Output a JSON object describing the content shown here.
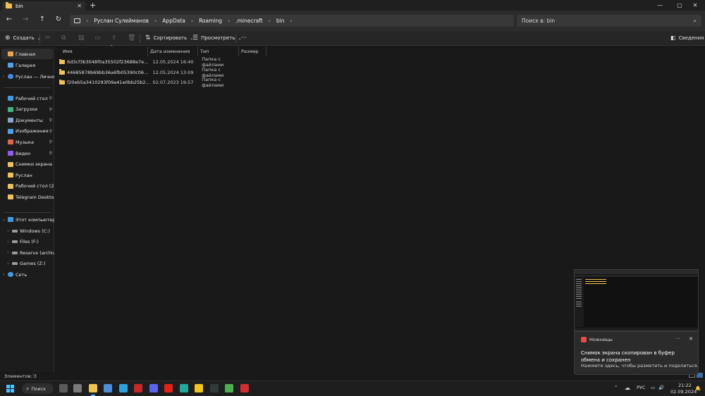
{
  "tab": {
    "title": "bin",
    "close": "✕",
    "new": "+"
  },
  "window_controls": {
    "minimize": "—",
    "maximize": "▢",
    "close": "✕"
  },
  "nav": {
    "back": "←",
    "forward": "→",
    "up": "↑",
    "refresh": "↻"
  },
  "breadcrumbs": [
    "Руслан Сулейманов",
    "AppData",
    "Roaming",
    ".minecraft",
    "bin"
  ],
  "search": {
    "placeholder": "Поиск в: bin"
  },
  "commands": {
    "create": "Создать",
    "sort": "Сортировать",
    "view": "Просмотреть",
    "more": "···",
    "details": "Сведения"
  },
  "sidebar": {
    "top": [
      {
        "label": "Главная",
        "icon": "home-icon",
        "color": "#f0a14a",
        "active": true
      },
      {
        "label": "Галерея",
        "icon": "gallery-icon",
        "color": "#4aa3f0"
      },
      {
        "label": "Руслан — Личное",
        "icon": "onedrive-icon",
        "color": "#3c8ee6"
      }
    ],
    "pinned": [
      {
        "label": "Рабочий стол",
        "icon": "desktop-icon",
        "color": "#3d9be9",
        "pin": "📌"
      },
      {
        "label": "Загрузки",
        "icon": "download-icon",
        "color": "#3fb27f",
        "pin": "📌"
      },
      {
        "label": "Документы",
        "icon": "documents-icon",
        "color": "#8aa4c8",
        "pin": "📌"
      },
      {
        "label": "Изображения",
        "icon": "pictures-icon",
        "color": "#4aa3f0",
        "pin": "📌"
      },
      {
        "label": "Музыка",
        "icon": "music-icon",
        "color": "#e8624a",
        "pin": "📌"
      },
      {
        "label": "Видео",
        "icon": "video-icon",
        "color": "#8b5cf6",
        "pin": "📌"
      },
      {
        "label": "Снимки экрана",
        "icon": "folder-icon",
        "color": "#f2c14e"
      },
      {
        "label": "Руслан",
        "icon": "folder-icon",
        "color": "#f2c14e"
      },
      {
        "label": "Рабочий стол (25.0",
        "icon": "folder-icon",
        "color": "#f2c14e"
      },
      {
        "label": "Telegram Desktop",
        "icon": "folder-icon",
        "color": "#f2c14e"
      }
    ],
    "this_pc": {
      "label": "Этот компьютер",
      "icon": "computer-icon",
      "color": "#3d9be9"
    },
    "drives": [
      {
        "label": "Windows (C:)",
        "icon": "drive-icon"
      },
      {
        "label": "Files (F:)",
        "icon": "drive-icon"
      },
      {
        "label": "Reserve (archive)",
        "icon": "drive-icon"
      },
      {
        "label": "Games (Z:)",
        "icon": "drive-icon"
      }
    ],
    "network": {
      "label": "Сеть",
      "icon": "network-icon",
      "color": "#3d9be9"
    }
  },
  "columns": {
    "name": "Имя",
    "date": "Дата изменения",
    "type": "Тип",
    "size": "Размер"
  },
  "files": [
    {
      "name": "6d3cf3b3048f0a35502f23688e7e2a47d68...",
      "date": "12.05.2024 16:40",
      "type": "Папка с файлами"
    },
    {
      "name": "44685878b69bb36a6fb05390c06c8b0243...",
      "date": "12.05.2024 13:09",
      "type": "Папка с файлами"
    },
    {
      "name": "f20eb5a3410293f09a41e0bb25b2fc3d98f...",
      "date": "02.07.2023 19:57",
      "type": "Папка с файлами"
    }
  ],
  "status": {
    "items": "Элементов: 3"
  },
  "notification": {
    "app": "Ножницы",
    "menu": "···",
    "close": "✕",
    "title": "Снимок экрана скопирован в буфер обмена и сохранен",
    "body": "Нажмите здесь, чтобы разметить и поделиться."
  },
  "taskbar": {
    "search": "Поиск",
    "lang": "РУС",
    "time": "21:22",
    "date": "02.09.2024",
    "apps": [
      {
        "name": "taskview-icon",
        "color": "#5a5a5a"
      },
      {
        "name": "minecraft-icon",
        "color": "#7a7a7a"
      },
      {
        "name": "explorer-icon",
        "color": "#f2c14e",
        "active": true
      },
      {
        "name": "photos-icon",
        "color": "#4a8fd8"
      },
      {
        "name": "telegram-icon",
        "color": "#2aa3e0"
      },
      {
        "name": "app-red-icon",
        "color": "#c62828"
      },
      {
        "name": "discord-icon",
        "color": "#5865f2"
      },
      {
        "name": "youtube-icon",
        "color": "#e62117"
      },
      {
        "name": "edge-icon",
        "color": "#1fa99f"
      },
      {
        "name": "app-yellow-icon",
        "color": "#f5c518"
      },
      {
        "name": "app-dark-icon",
        "color": "#2f3b3b"
      },
      {
        "name": "app-green-icon",
        "color": "#4caf50"
      },
      {
        "name": "app-red2-icon",
        "color": "#d32f2f"
      }
    ]
  }
}
